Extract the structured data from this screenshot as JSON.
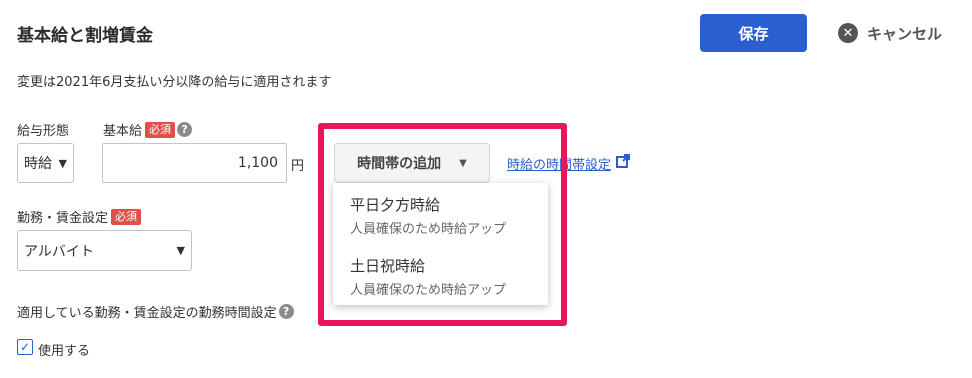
{
  "header": {
    "title": "基本給と割増賃金",
    "save_label": "保存",
    "cancel_label": "キャンセル"
  },
  "notice": "変更は2021年6月支払い分以降の給与に適用されます",
  "pay_type": {
    "label": "給与形態",
    "value": "時給"
  },
  "base_pay": {
    "label": "基本給",
    "required": "必須",
    "value": "1,100",
    "unit": "円"
  },
  "timeband": {
    "button_label": "時間帯の追加",
    "settings_link": "時給の時間帯設定",
    "options": [
      {
        "name": "平日夕方時給",
        "description": "人員確保のため時給アップ"
      },
      {
        "name": "土日祝時給",
        "description": "人員確保のため時給アップ"
      }
    ]
  },
  "work_setting": {
    "label": "勤務・賃金設定",
    "required": "必須",
    "value": "アルバイト"
  },
  "work_hours": {
    "label": "適用している勤務・賃金設定の勤務時間設定",
    "checkbox_label": "使用する",
    "checked": true
  },
  "colors": {
    "primary": "#2a5fcf",
    "required_badge": "#e0504b",
    "highlight": "#e8175d"
  },
  "icons": [
    "close-icon",
    "help-icon",
    "chevron-down-icon",
    "external-link-icon",
    "check-icon"
  ]
}
